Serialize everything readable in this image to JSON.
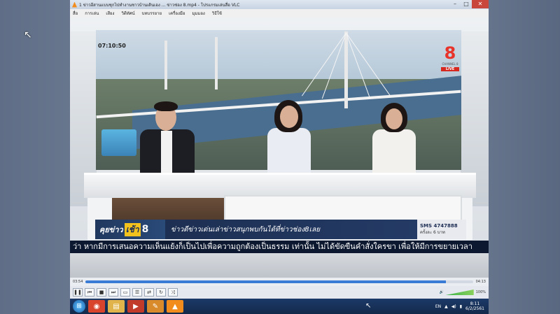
{
  "window": {
    "title": "1 ข่าวอีสานแบบชุกไปทำงานชาวบ้านเดินเอง ... ข่าวช่อง 8.mp4 - โปรแกรมเล่นสื่อ VLC",
    "minimize": "–",
    "maximize": "□",
    "close": "✕"
  },
  "menu": [
    "สื่อ",
    "การเล่น",
    "เสียง",
    "วิดีทัศน์",
    "บทบรรยาย",
    "เครื่องมือ",
    "มุมมอง",
    "วิธีใช้"
  ],
  "overlay": {
    "time": "07:10:50",
    "channel_logo": "8",
    "channel_name": "CHANNEL 8",
    "live": "LIVE"
  },
  "lower_third": {
    "show_part1": "คุยข่าว",
    "show_part2": "เช้า",
    "show_part3": "8",
    "headline": "ข่าวดีข่าวเด่นเล่าข่าวสนุกพบกันได้ที่ข่าวช่อง8เลย",
    "sms_number": "SMS 4747888",
    "sms_price": "ครั้งละ 6 บาท"
  },
  "ticker": "ว่า หากมีการเสนอความเห็นแย้งก็เป็นไปเพื่อความถูกต้องเป็นธรรม เท่านั้น ไม่ได้ขัดขืนคำสั่งใครขา เพื่อให้มีการขยายเวลา",
  "player": {
    "elapsed": "03:54",
    "total": "04:13",
    "progress": 0.93,
    "volume_label": "100%"
  },
  "controls": [
    "❚❚",
    "⏮",
    "■",
    "⏭",
    "▭",
    "☰",
    "⇄",
    "↻",
    "⤨"
  ],
  "taskbar": {
    "start": "⊞",
    "apps": [
      {
        "name": "chrome",
        "glyph": "◉",
        "color": "#d9442c"
      },
      {
        "name": "explorer",
        "glyph": "▤",
        "color": "#e0b44a"
      },
      {
        "name": "media",
        "glyph": "▶",
        "color": "#c13a2a"
      },
      {
        "name": "paint",
        "glyph": "✎",
        "color": "#d98a2a"
      },
      {
        "name": "vlc",
        "glyph": "▲",
        "color": "#f28c1c"
      }
    ],
    "lang": "EN",
    "time": "8:11",
    "date": "6/2/2561"
  }
}
